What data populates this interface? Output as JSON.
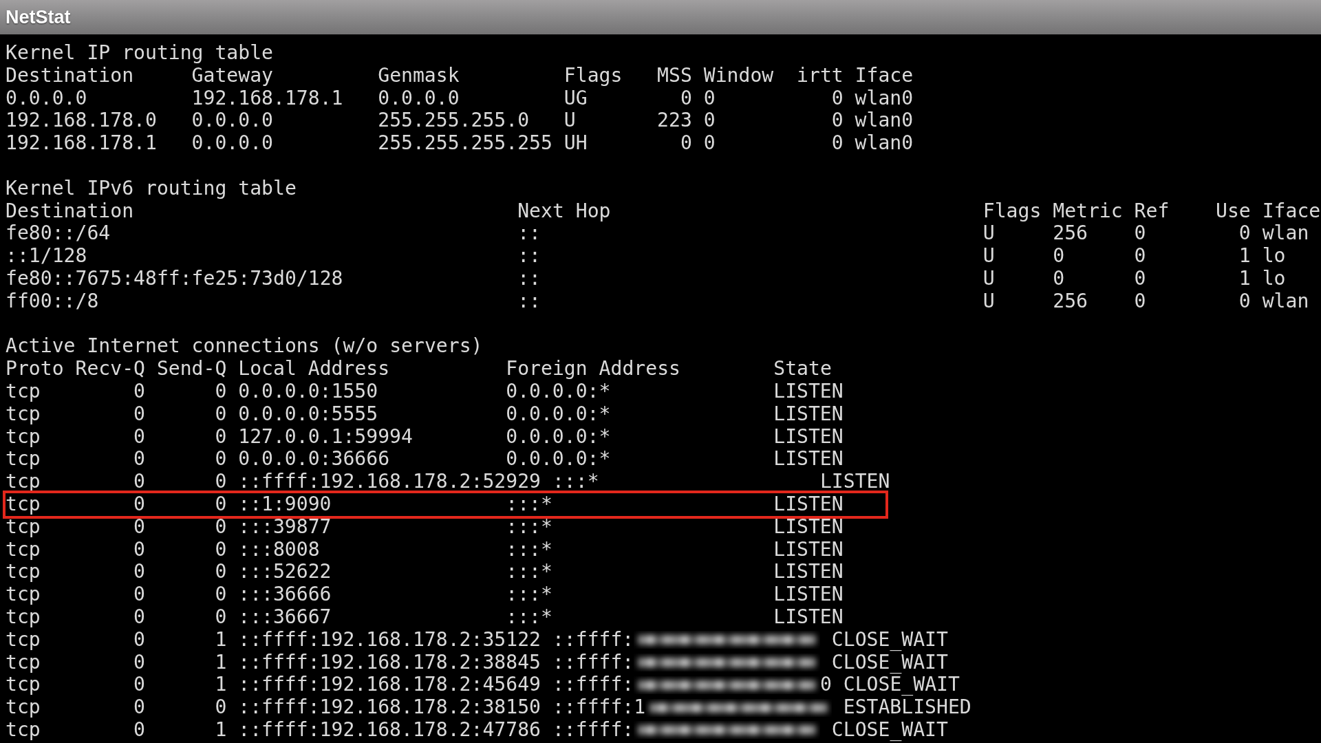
{
  "window": {
    "title": "NetStat"
  },
  "ipv4_routing": {
    "title": "Kernel IP routing table",
    "columns": [
      "Destination",
      "Gateway",
      "Genmask",
      "Flags",
      "MSS",
      "Window",
      "irtt",
      "Iface"
    ],
    "rows": [
      [
        "0.0.0.0",
        "192.168.178.1",
        "0.0.0.0",
        "UG",
        "0",
        "0",
        "0",
        "wlan0"
      ],
      [
        "192.168.178.0",
        "0.0.0.0",
        "255.255.255.0",
        "U",
        "223",
        "0",
        "0",
        "wlan0"
      ],
      [
        "192.168.178.1",
        "0.0.0.0",
        "255.255.255.255",
        "UH",
        "0",
        "0",
        "0",
        "wlan0"
      ]
    ]
  },
  "ipv6_routing": {
    "title": "Kernel IPv6 routing table",
    "columns": [
      "Destination",
      "Next Hop",
      "Flags",
      "Metric",
      "Ref",
      "Use",
      "Iface"
    ],
    "rows": [
      [
        "fe80::/64",
        "::",
        "U",
        "256",
        "0",
        "0",
        "wlan"
      ],
      [
        "::1/128",
        "::",
        "U",
        "0",
        "0",
        "1",
        "lo"
      ],
      [
        "fe80::7675:48ff:fe25:73d0/128",
        "::",
        "U",
        "0",
        "0",
        "1",
        "lo"
      ],
      [
        "ff00::/8",
        "::",
        "U",
        "256",
        "0",
        "0",
        "wlan"
      ]
    ]
  },
  "connections": {
    "title": "Active Internet connections (w/o servers)",
    "columns": [
      "Proto",
      "Recv-Q",
      "Send-Q",
      "Local Address",
      "Foreign Address",
      "State"
    ],
    "rows": [
      {
        "proto": "tcp",
        "recv_q": "0",
        "send_q": "0",
        "local_address": "0.0.0.0:1550",
        "foreign_address": "0.0.0.0:*",
        "redacted": false,
        "state": "LISTEN",
        "highlighted": false
      },
      {
        "proto": "tcp",
        "recv_q": "0",
        "send_q": "0",
        "local_address": "0.0.0.0:5555",
        "foreign_address": "0.0.0.0:*",
        "redacted": false,
        "state": "LISTEN",
        "highlighted": false
      },
      {
        "proto": "tcp",
        "recv_q": "0",
        "send_q": "0",
        "local_address": "127.0.0.1:59994",
        "foreign_address": "0.0.0.0:*",
        "redacted": false,
        "state": "LISTEN",
        "highlighted": false
      },
      {
        "proto": "tcp",
        "recv_q": "0",
        "send_q": "0",
        "local_address": "0.0.0.0:36666",
        "foreign_address": "0.0.0.0:*",
        "redacted": false,
        "state": "LISTEN",
        "highlighted": false
      },
      {
        "proto": "tcp",
        "recv_q": "0",
        "send_q": "0",
        "local_address": "::ffff:192.168.178.2:52929",
        "foreign_address": ":::*",
        "redacted": false,
        "state": "LISTEN",
        "highlighted": false
      },
      {
        "proto": "tcp",
        "recv_q": "0",
        "send_q": "0",
        "local_address": "::1:9090",
        "foreign_address": ":::*",
        "redacted": false,
        "state": "LISTEN",
        "highlighted": true
      },
      {
        "proto": "tcp",
        "recv_q": "0",
        "send_q": "0",
        "local_address": ":::39877",
        "foreign_address": ":::*",
        "redacted": false,
        "state": "LISTEN",
        "highlighted": false
      },
      {
        "proto": "tcp",
        "recv_q": "0",
        "send_q": "0",
        "local_address": ":::8008",
        "foreign_address": ":::*",
        "redacted": false,
        "state": "LISTEN",
        "highlighted": false
      },
      {
        "proto": "tcp",
        "recv_q": "0",
        "send_q": "0",
        "local_address": ":::52622",
        "foreign_address": ":::*",
        "redacted": false,
        "state": "LISTEN",
        "highlighted": false
      },
      {
        "proto": "tcp",
        "recv_q": "0",
        "send_q": "0",
        "local_address": ":::36666",
        "foreign_address": ":::*",
        "redacted": false,
        "state": "LISTEN",
        "highlighted": false
      },
      {
        "proto": "tcp",
        "recv_q": "0",
        "send_q": "0",
        "local_address": ":::36667",
        "foreign_address": ":::*",
        "redacted": false,
        "state": "LISTEN",
        "highlighted": false
      },
      {
        "proto": "tcp",
        "recv_q": "0",
        "send_q": "1",
        "local_address": "::ffff:192.168.178.2:35122",
        "foreign_address": "::ffff:",
        "redacted": true,
        "state": "CLOSE_WAIT",
        "highlighted": false
      },
      {
        "proto": "tcp",
        "recv_q": "0",
        "send_q": "1",
        "local_address": "::ffff:192.168.178.2:38845",
        "foreign_address": "::ffff:",
        "redacted": true,
        "state": "CLOSE_WAIT",
        "highlighted": false
      },
      {
        "proto": "tcp",
        "recv_q": "0",
        "send_q": "1",
        "local_address": "::ffff:192.168.178.2:45649",
        "foreign_address": "::ffff:",
        "redacted": true,
        "foreign_suffix": "0",
        "state": "CLOSE_WAIT",
        "highlighted": false
      },
      {
        "proto": "tcp",
        "recv_q": "0",
        "send_q": "0",
        "local_address": "::ffff:192.168.178.2:38150",
        "foreign_address": "::ffff:1",
        "redacted": true,
        "state": "ESTABLISHED",
        "highlighted": false
      },
      {
        "proto": "tcp",
        "recv_q": "0",
        "send_q": "1",
        "local_address": "::ffff:192.168.178.2:47786",
        "foreign_address": "::ffff:",
        "redacted": true,
        "state": "CLOSE_WAIT",
        "highlighted": false
      }
    ]
  }
}
